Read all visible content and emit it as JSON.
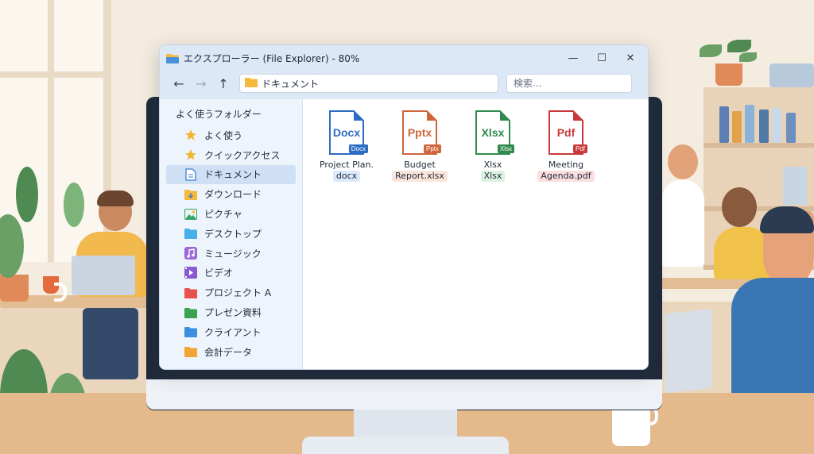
{
  "window": {
    "title": "エクスプローラー (File Explorer) - 80%",
    "minimize": "—",
    "maximize": "☐",
    "close": "✕"
  },
  "nav": {
    "back": "←",
    "forward": "→",
    "up": "↑",
    "address": "ドキュメント",
    "search_placeholder": "検索..."
  },
  "sidebar": {
    "heading": "よく使うフォルダー",
    "items": [
      {
        "label": "よく使う",
        "icon": "star-icon",
        "color": "#f2b632"
      },
      {
        "label": "クイックアクセス",
        "icon": "star-icon",
        "color": "#f2b632"
      },
      {
        "label": "ドキュメント",
        "icon": "document-icon",
        "color": "#3b82d6",
        "selected": true
      },
      {
        "label": "ダウンロード",
        "icon": "download-folder-icon",
        "color": "#f5b93b"
      },
      {
        "label": "ピクチャ",
        "icon": "pictures-icon",
        "color": "#3aa56a"
      },
      {
        "label": "デスクトップ",
        "icon": "desktop-folder-icon",
        "color": "#45b0e8"
      },
      {
        "label": "ミュージック",
        "icon": "music-icon",
        "color": "#9a6ad8"
      },
      {
        "label": "ビデオ",
        "icon": "video-icon",
        "color": "#8a5ad0"
      },
      {
        "label": "プロジェクト A",
        "icon": "folder-icon",
        "color": "#e5534b"
      },
      {
        "label": "プレゼン資料",
        "icon": "folder-icon",
        "color": "#3aa350"
      },
      {
        "label": "クライアント",
        "icon": "folder-icon",
        "color": "#3b8fe0"
      },
      {
        "label": "会計データ",
        "icon": "folder-icon",
        "color": "#f2a532"
      }
    ]
  },
  "files": [
    {
      "icon_text": "Docx",
      "badge": "Docx",
      "name_line1": "Project Plan.",
      "name_line2": "docx",
      "color": "#2b6cc4",
      "tint": "#dce9fb"
    },
    {
      "icon_text": "Pptx",
      "badge": "Pptx",
      "name_line1": "Budget",
      "name_line2": "Report.xlsx",
      "color": "#d0643a",
      "tint": "#fbe4da"
    },
    {
      "icon_text": "Xlsx",
      "badge": "Xlsx",
      "name_line1": "Xlsx",
      "name_line2": "Xlsx",
      "color": "#2f8a4e",
      "tint": "#dcf1e2"
    },
    {
      "icon_text": "Pdf",
      "badge": "Pdf",
      "name_line1": "Meeting",
      "name_line2": "Agenda.pdf",
      "color": "#c8383a",
      "tint": "#fbdede"
    }
  ]
}
